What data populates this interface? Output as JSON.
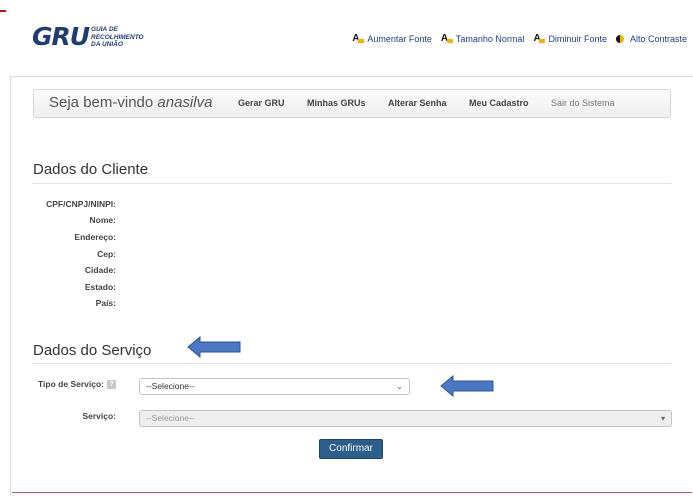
{
  "header": {
    "logo_mark": "GRU",
    "logo_text": [
      "Guia de",
      "Recolhimento",
      "da União"
    ],
    "accessibility": [
      {
        "label": "Aumentar Fonte",
        "icon": "font-size-icon"
      },
      {
        "label": "Tamanho Normal",
        "icon": "font-size-icon"
      },
      {
        "label": "Diminuir Fonte",
        "icon": "font-size-icon"
      },
      {
        "label": "Alto Contraste",
        "icon": "contrast-icon"
      }
    ]
  },
  "navbar": {
    "welcome_prefix": "Seja bem-vindo",
    "username": "anasilva",
    "links": [
      "Gerar GRU",
      "Minhas GRUs",
      "Alterar Senha",
      "Meu Cadastro",
      "Sair do Sistema"
    ]
  },
  "client": {
    "title": "Dados do Cliente",
    "fields": [
      "CPF/CNPJ/NINPI:",
      "Nome:",
      "Endereço:",
      "Cep:",
      "Cidade:",
      "Estado:",
      "País:"
    ]
  },
  "service": {
    "title": "Dados do Serviço",
    "type_label": "Tipo de Serviço:",
    "help": "?",
    "type_value": "--Selecione--",
    "service_label": "Serviço:",
    "service_value": "--Selecione--",
    "confirm": "Confirmar"
  },
  "colors": {
    "accent": "#2a5e8c",
    "arrow": "#4a78c2",
    "logo": "#1e3e73"
  }
}
